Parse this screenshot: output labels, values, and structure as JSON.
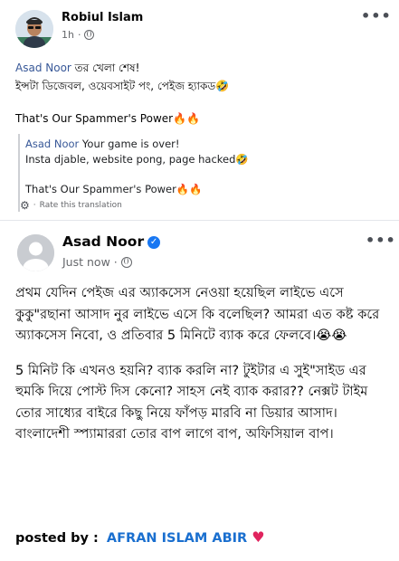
{
  "post1": {
    "author": "Robiul Islam",
    "time": "1h",
    "more_label": "•••",
    "mention": "Asad Noor",
    "line1_rest": " তর খেলা শেষ!",
    "line2": "ইন্সটা ডিজেবল, ওয়েবসাইট পং, পেইজ হ্যাকড🤣",
    "line3": "That's Our Spammer's Power🔥🔥",
    "translation": {
      "mention": "Asad Noor",
      "line1_rest": " Your game is over!",
      "line2": "Insta djable, website pong, page hacked🤣",
      "line3": "That's Our Spammer's Power🔥🔥",
      "rate_label": "Rate this translation"
    }
  },
  "post2": {
    "author": "Asad Noor",
    "time": "Just now",
    "more_label": "•••",
    "para1": "প্রথম যেদিন পেইজ এর অ্যাকসেস নেওয়া হয়েছিল লাইভে এসে কুকু\"রছানা আসাদ নুর লাইভে এসে কি বলেছিল? আমরা এত কষ্ট করে অ্যাকসেস নিবো, ও প্রতিবার 5 মিনিটে ব্যাক করে ফেলবে।😭😭",
    "para2": "5 মিনিট কি এখনও হয়নি? ব্যাক করলি না? টুইটার এ সুই\"সাইড এর হুমকি দিয়ে পোস্ট দিস কেনো? সাহস নেই ব্যাক করার?? নেক্সট টাইম তোর সাধ্যের বাইরে কিছু নিয়ে ফাঁপড় মারবি না ডিয়ার আসাদ। বাংলাদেশী স্প্যামাররা তোর বাপ লাগে বাপ, অফিসিয়াল বাপ।",
    "posted_label": "posted by :",
    "posted_name": "AFRAN ISLAM ABIR"
  },
  "colors": {
    "mention": "#385898",
    "verified": "#1877f2",
    "posted_name": "#1a6fcf",
    "heart": "#e0245e"
  }
}
